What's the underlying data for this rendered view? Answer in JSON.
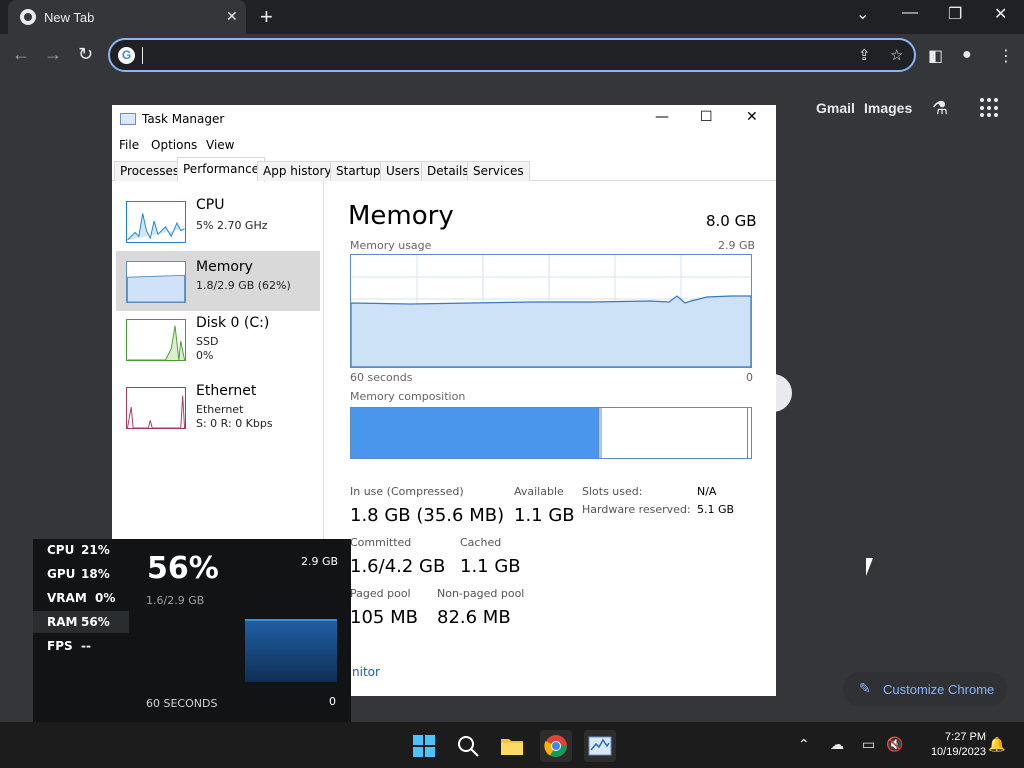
{
  "browser": {
    "tab_title": "New Tab",
    "tab_close": "✕",
    "new_tab": "+",
    "window_controls": [
      "⌄",
      "—",
      "❐",
      "✕"
    ],
    "omnibox_value": ""
  },
  "ntp": {
    "gmail": "Gmail",
    "images": "Images",
    "labs_icon": "flask-icon",
    "apps_icon": "grid-icon",
    "customize_label": "Customize Chrome"
  },
  "task_manager": {
    "title": "Task Manager",
    "menu": [
      "File",
      "Options",
      "View"
    ],
    "tabs": [
      "Processes",
      "Performance",
      "App history",
      "Startup",
      "Users",
      "Details",
      "Services"
    ],
    "active_tab": "Performance",
    "sidebar": [
      {
        "name": "CPU",
        "line1": "5% 2.70 GHz",
        "line2": ""
      },
      {
        "name": "Memory",
        "line1": "1.8/2.9 GB (62%)",
        "line2": ""
      },
      {
        "name": "Disk 0 (C:)",
        "line1": "SSD",
        "line2": "0%"
      },
      {
        "name": "Ethernet",
        "line1": "Ethernet",
        "line2": "S: 0 R: 0 Kbps"
      }
    ],
    "main": {
      "title": "Memory",
      "total": "8.0 GB",
      "usage_label": "Memory usage",
      "usage_max": "2.9 GB",
      "axis_left": "60 seconds",
      "axis_right": "0",
      "composition_label": "Memory composition",
      "in_use_label": "In use (Compressed)",
      "in_use_value": "1.8 GB (35.6 MB)",
      "available_label": "Available",
      "available_value": "1.1 GB",
      "slots_label": "Slots used:",
      "slots_value": "N/A",
      "hw_reserved_label": "Hardware reserved:",
      "hw_reserved_value": "5.1 GB",
      "committed_label": "Committed",
      "committed_value": "1.6/4.2 GB",
      "cached_label": "Cached",
      "cached_value": "1.1 GB",
      "paged_label": "Paged pool",
      "paged_value": "105 MB",
      "nonpaged_label": "Non-paged pool",
      "nonpaged_value": "82.6 MB",
      "monitor_link": "nitor"
    }
  },
  "overlay": {
    "rows": [
      {
        "k": "CPU",
        "v": "21%"
      },
      {
        "k": "GPU",
        "v": "18%"
      },
      {
        "k": "VRAM",
        "v": "0%"
      },
      {
        "k": "RAM",
        "v": "56%"
      },
      {
        "k": "FPS",
        "v": "--"
      }
    ],
    "big": "56%",
    "max": "2.9 GB",
    "sub": "1.6/2.9 GB",
    "seconds": "60 SECONDS",
    "zero": "0"
  },
  "taskbar": {
    "time": "7:27 PM",
    "date": "10/19/2023"
  },
  "colors": {
    "accent": "#8ab4f8",
    "memory_fill": "#4a96ec"
  }
}
